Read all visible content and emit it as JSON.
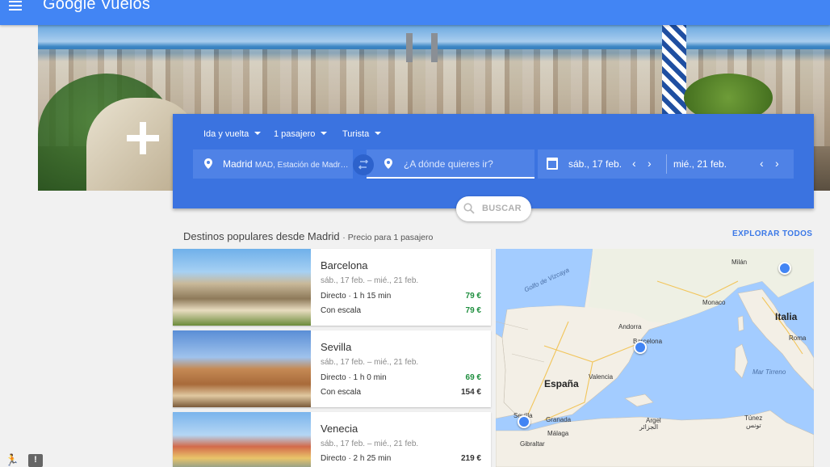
{
  "app": {
    "title": "Google Vuelos"
  },
  "search": {
    "trip_type": "Ida y vuelta",
    "passengers": "1 pasajero",
    "cabin": "Turista",
    "origin_city": "Madrid",
    "origin_detail": "MAD, Estación de Madr…",
    "destination_placeholder": "¿A dónde quieres ir?",
    "depart_date": "sáb., 17 feb.",
    "return_date": "mié., 21 feb.",
    "button_label": "BUSCAR"
  },
  "section": {
    "title": "Destinos populares desde Madrid",
    "subtitle": "· Precio para 1 pasajero",
    "explore_label": "EXPLORAR TODOS"
  },
  "destinations": [
    {
      "city": "Barcelona",
      "dates": "sáb., 17 feb. – mié., 21 feb.",
      "direct_label": "Directo · 1 h 15 min",
      "direct_price": "79 €",
      "stop_label": "Con escala",
      "stop_price": "79 €"
    },
    {
      "city": "Sevilla",
      "dates": "sáb., 17 feb. – mié., 21 feb.",
      "direct_label": "Directo · 1 h 0 min",
      "direct_price": "69 €",
      "stop_label": "Con escala",
      "stop_price": "154 €"
    },
    {
      "city": "Venecia",
      "dates": "sáb., 17 feb. – mié., 21 feb.",
      "direct_label": "Directo · 2 h 25 min",
      "direct_price": "219 €"
    }
  ],
  "map": {
    "labels": {
      "milan": "Milán",
      "golfo": "Golfo de Vizcaya",
      "monaco": "Monaco",
      "italia": "Italia",
      "andorra": "Andorra",
      "barcelona": "Barcelona",
      "roma": "Roma",
      "valencia": "Valencia",
      "espana": "España",
      "mar_tirreno": "Mar Tirreno",
      "sevilla": "Sevilla",
      "granada": "Granada",
      "argel": "Argel",
      "argel_ar": "الجزائر",
      "tunez": "Túnez",
      "tunez_ar": "تونس",
      "malaga": "Málaga",
      "gibraltar": "Gibraltar"
    }
  },
  "icons": {
    "menu": "menu-icon",
    "location": "location-pin-icon",
    "swap": "swap-icon",
    "calendar": "calendar-icon",
    "search": "search-icon",
    "accessibility": "accessibility-icon",
    "feedback": "feedback-icon"
  },
  "colors": {
    "header_blue": "#4285f4",
    "panel_blue": "#3b73e0",
    "price_green": "#1e8e3e",
    "link_blue": "#3b78e7"
  }
}
